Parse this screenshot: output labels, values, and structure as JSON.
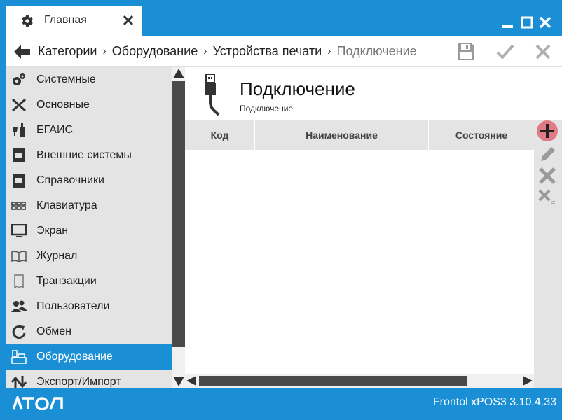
{
  "window": {
    "tab_title": "Главная",
    "tab_icon": "gear-icon",
    "controls": [
      "minimize-icon",
      "maximize-icon",
      "close-icon"
    ]
  },
  "navbar": {
    "breadcrumb": [
      "Категории",
      "Оборудование",
      "Устройства печати",
      "Подключение"
    ],
    "actions": [
      "save-icon",
      "check-icon",
      "close-icon"
    ]
  },
  "sidebar": {
    "items": [
      {
        "label": "Системные",
        "icon": "gears-icon"
      },
      {
        "label": "Основные",
        "icon": "tools-icon"
      },
      {
        "label": "ЕГАИС",
        "icon": "bottles-icon"
      },
      {
        "label": "Внешние системы",
        "icon": "book-icon"
      },
      {
        "label": "Справочники",
        "icon": "book-icon"
      },
      {
        "label": "Клавиатура",
        "icon": "keyboard-icon"
      },
      {
        "label": "Экран",
        "icon": "monitor-icon"
      },
      {
        "label": "Журнал",
        "icon": "journal-icon"
      },
      {
        "label": "Транзакции",
        "icon": "receipt-icon"
      },
      {
        "label": "Пользователи",
        "icon": "users-icon"
      },
      {
        "label": "Обмен",
        "icon": "sync-icon"
      },
      {
        "label": "Оборудование",
        "icon": "cash-register-icon",
        "active": true
      },
      {
        "label": "Экспорт/Импорт",
        "icon": "export-import-icon"
      }
    ]
  },
  "content": {
    "title": "Подключение",
    "subtitle": "Подключение",
    "icon": "usb-icon",
    "table": {
      "columns": [
        "Код",
        "Наименование",
        "Состояние"
      ],
      "rows": []
    },
    "tools": [
      "add-icon",
      "edit-icon",
      "delete-icon",
      "delete-all-icon"
    ]
  },
  "status": {
    "logo": "АТОЛ",
    "version": "Frontol xPOS3 3.10.4.33"
  },
  "colors": {
    "accent": "#1a8fd6",
    "sidebar_bg": "#e4e4e4",
    "add_highlight": "#e07a86"
  }
}
